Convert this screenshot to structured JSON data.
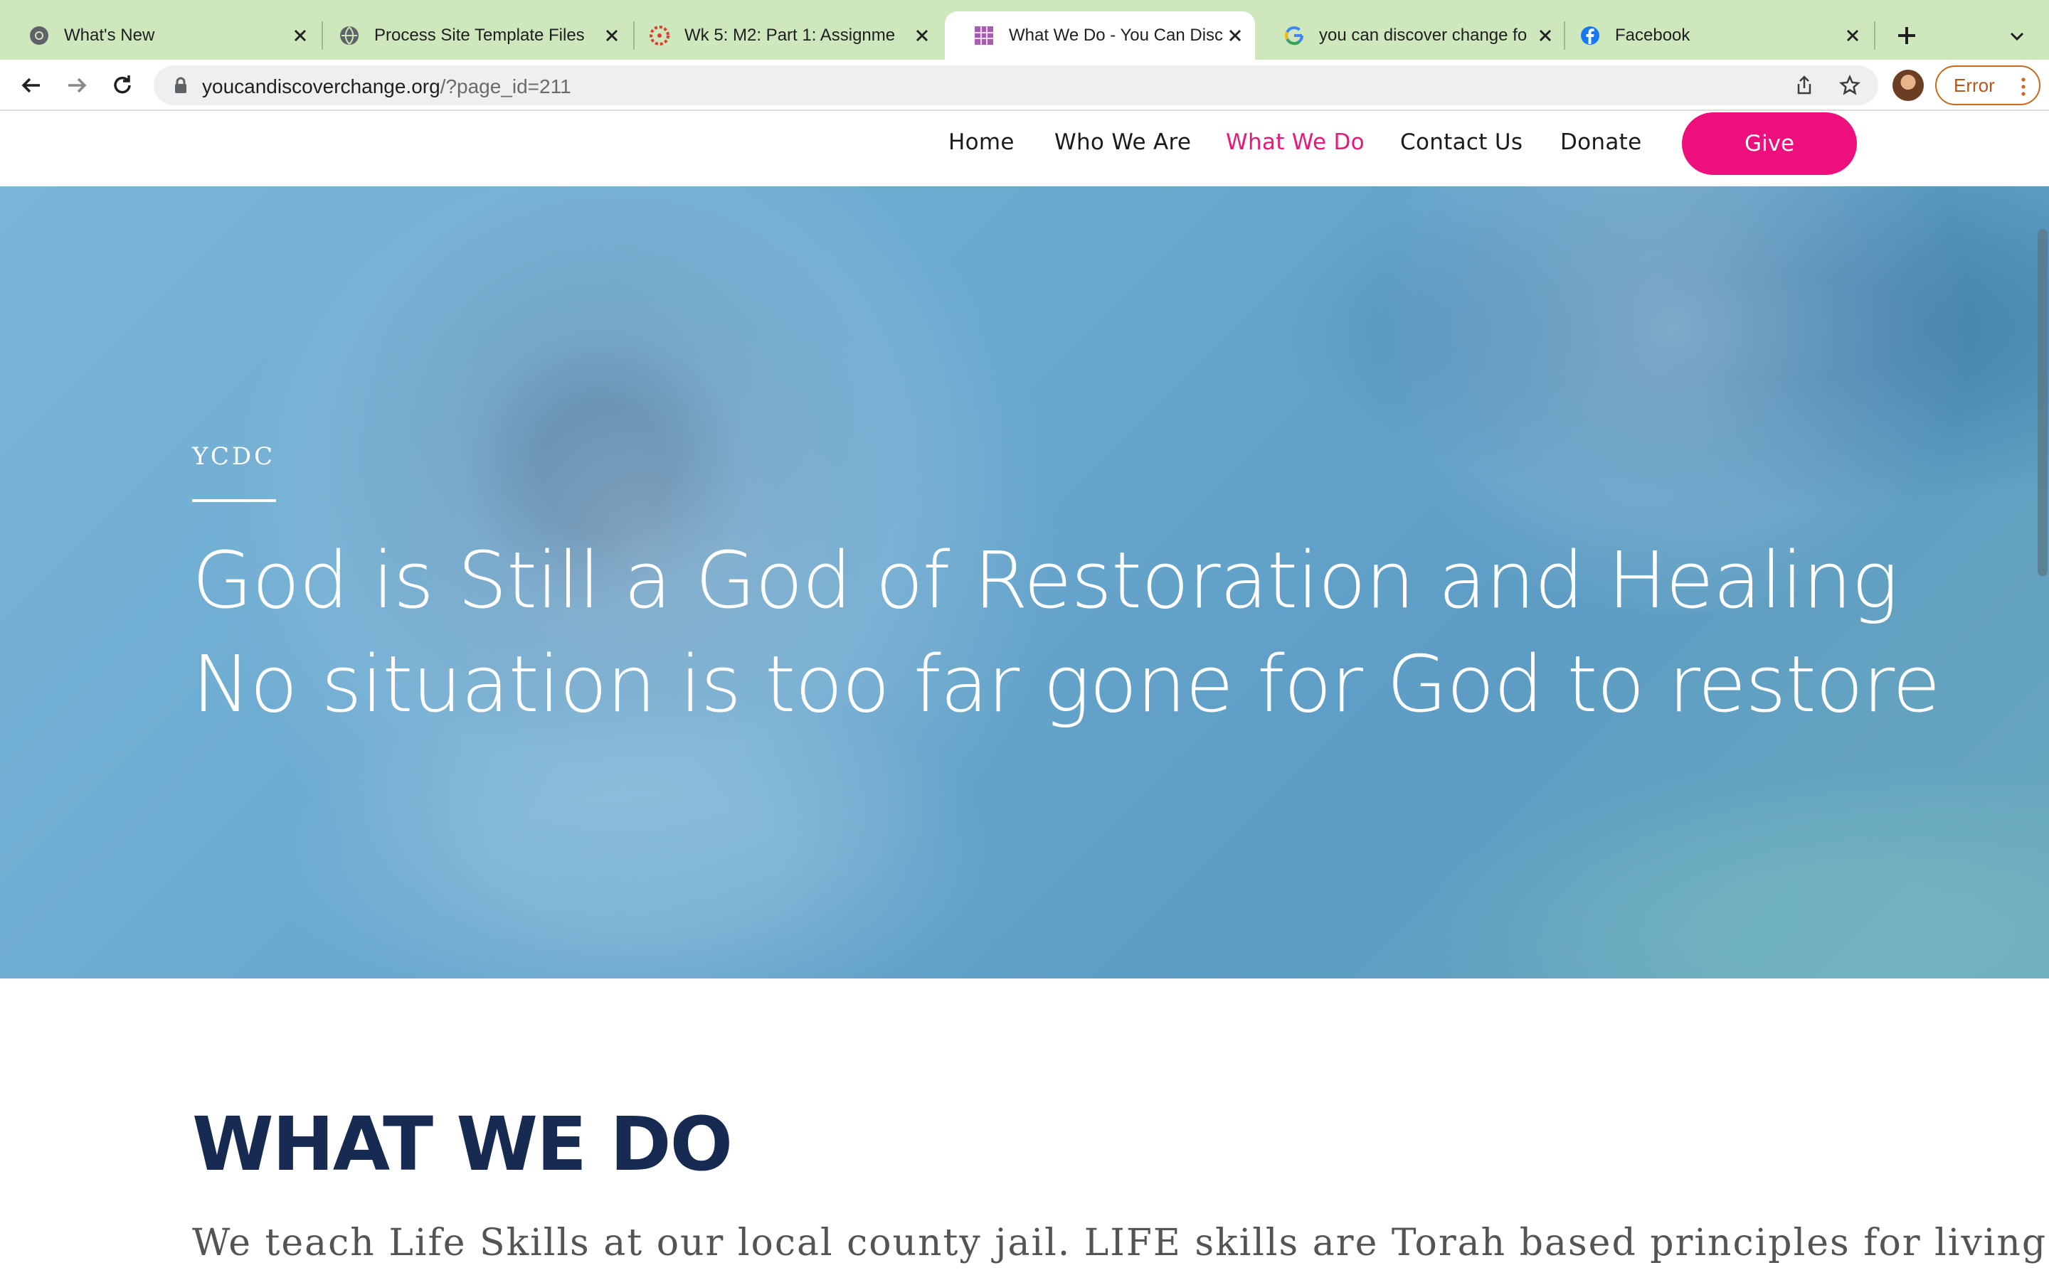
{
  "browser": {
    "tabs": [
      {
        "title": "What's New",
        "icon": "chrome-icon",
        "active": false
      },
      {
        "title": "Process Site Template Files",
        "icon": "globe-icon",
        "active": false
      },
      {
        "title": "Wk 5: M2: Part 1: Assignme",
        "icon": "canvas-lms-icon",
        "active": false
      },
      {
        "title": "What We Do - You Can Disc",
        "icon": "site-grid-icon",
        "active": true
      },
      {
        "title": "you can discover change fo",
        "icon": "google-icon",
        "active": false
      },
      {
        "title": "Facebook",
        "icon": "facebook-icon",
        "active": false
      }
    ],
    "url_domain": "youcandiscoverchange.org",
    "url_path": "/?page_id=211",
    "profile_button_label": "Error"
  },
  "site": {
    "nav": {
      "home": "Home",
      "who_we_are": "Who We Are",
      "what_we_do": "What We Do",
      "contact_us": "Contact Us",
      "donate": "Donate",
      "give": "Give"
    },
    "hero": {
      "eyebrow": "YCDC",
      "line1": "God is Still a God of Restoration and Healing",
      "line2": "No situation is too far gone for God to restore"
    },
    "section": {
      "title": "WHAT WE DO",
      "body": "We teach Life Skills at our local county jail. LIFE skills are Torah based principles for living the"
    }
  },
  "colors": {
    "tabstrip": "#cfe7bd",
    "accent_pink": "#ed0f7c",
    "active_nav": "#e8197a",
    "heading_navy": "#172a52",
    "error_orange": "#c9691c"
  }
}
